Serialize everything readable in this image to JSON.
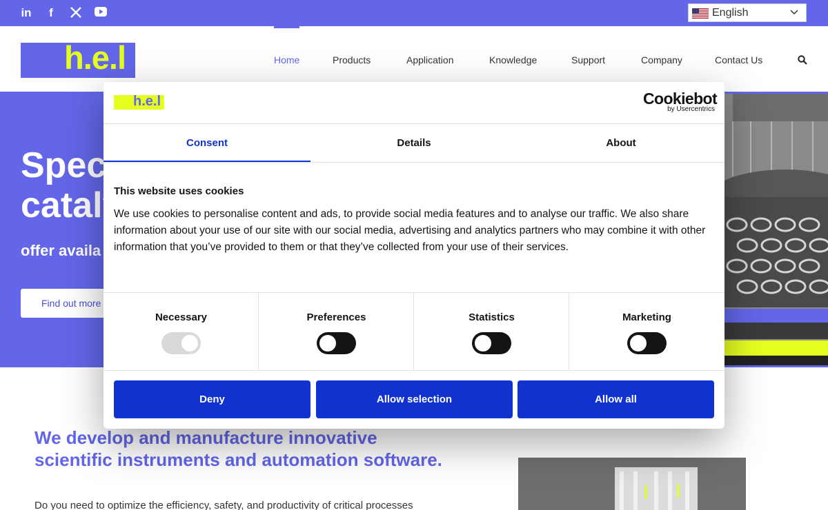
{
  "topbar": {
    "social": [
      "linkedin-icon",
      "facebook-icon",
      "x-icon",
      "youtube-icon"
    ],
    "language": "English"
  },
  "header": {
    "logo": "h.e.l",
    "nav": [
      "Home",
      "Products",
      "Application",
      "Knowledge",
      "Support",
      "Company",
      "Contact Us"
    ],
    "active_nav": "Home"
  },
  "hero": {
    "title_line1": "Spec",
    "title_line2": "cataly",
    "subtitle": "offer availa",
    "button": "Find out more"
  },
  "intro": {
    "tagline_line1": "We develop and manufacture innovative",
    "tagline_line2": "scientific instruments and automation software.",
    "body": "Do you need to optimize the efficiency, safety, and productivity of critical processes"
  },
  "cookie_dialog": {
    "logo": "h.e.l",
    "brand": "Cookiebot",
    "brand_sub": "by Usercentrics",
    "tabs": [
      "Consent",
      "Details",
      "About"
    ],
    "active_tab": "Consent",
    "heading": "This website uses cookies",
    "text": "We use cookies to personalise content and ads, to provide social media features and to analyse our traffic. We also share information about your use of our site with our social media, advertising and analytics partners who may combine it with other information that you’ve provided to them or that they’ve collected from your use of their services.",
    "categories": [
      {
        "label": "Necessary",
        "enabled": false,
        "checked": true
      },
      {
        "label": "Preferences",
        "enabled": true,
        "checked": false
      },
      {
        "label": "Statistics",
        "enabled": true,
        "checked": false
      },
      {
        "label": "Marketing",
        "enabled": true,
        "checked": false
      }
    ],
    "buttons": {
      "deny": "Deny",
      "allow_selection": "Allow selection",
      "allow_all": "Allow all"
    }
  },
  "colors": {
    "brand_purple": "#6366e8",
    "brand_yellow": "#e5ff21",
    "cookie_blue": "#1032cf"
  }
}
